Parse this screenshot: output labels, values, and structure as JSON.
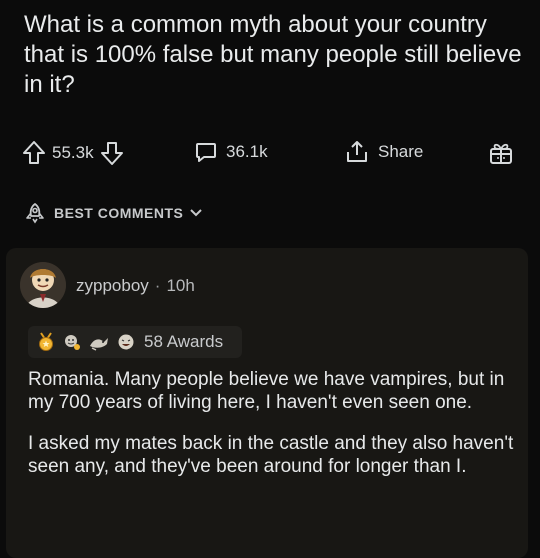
{
  "post": {
    "title": "What is a common myth about your country that is 100% false but many people still believe in it?"
  },
  "actions": {
    "upvotes": "55.3k",
    "comments": "36.1k",
    "share_label": "Share"
  },
  "sort": {
    "label": "BEST COMMENTS"
  },
  "comment": {
    "author": "zyppoboy",
    "separator": "·",
    "age": "10h",
    "awards_label": "58 Awards",
    "paragraphs": [
      "Romania. Many people believe we have vampires, but in my 700 years of living here, I haven't even seen one.",
      "I asked my mates back in the castle and they also haven't seen any, and they've been around for longer than I."
    ]
  },
  "colors": {
    "background": "#0b0b0b",
    "card": "#181714",
    "text": "#d7dadc"
  },
  "icons": [
    "upvote-icon",
    "downvote-icon",
    "comment-icon",
    "share-icon",
    "award-gift-icon",
    "sort-rocket-icon",
    "chevron-down-icon"
  ]
}
